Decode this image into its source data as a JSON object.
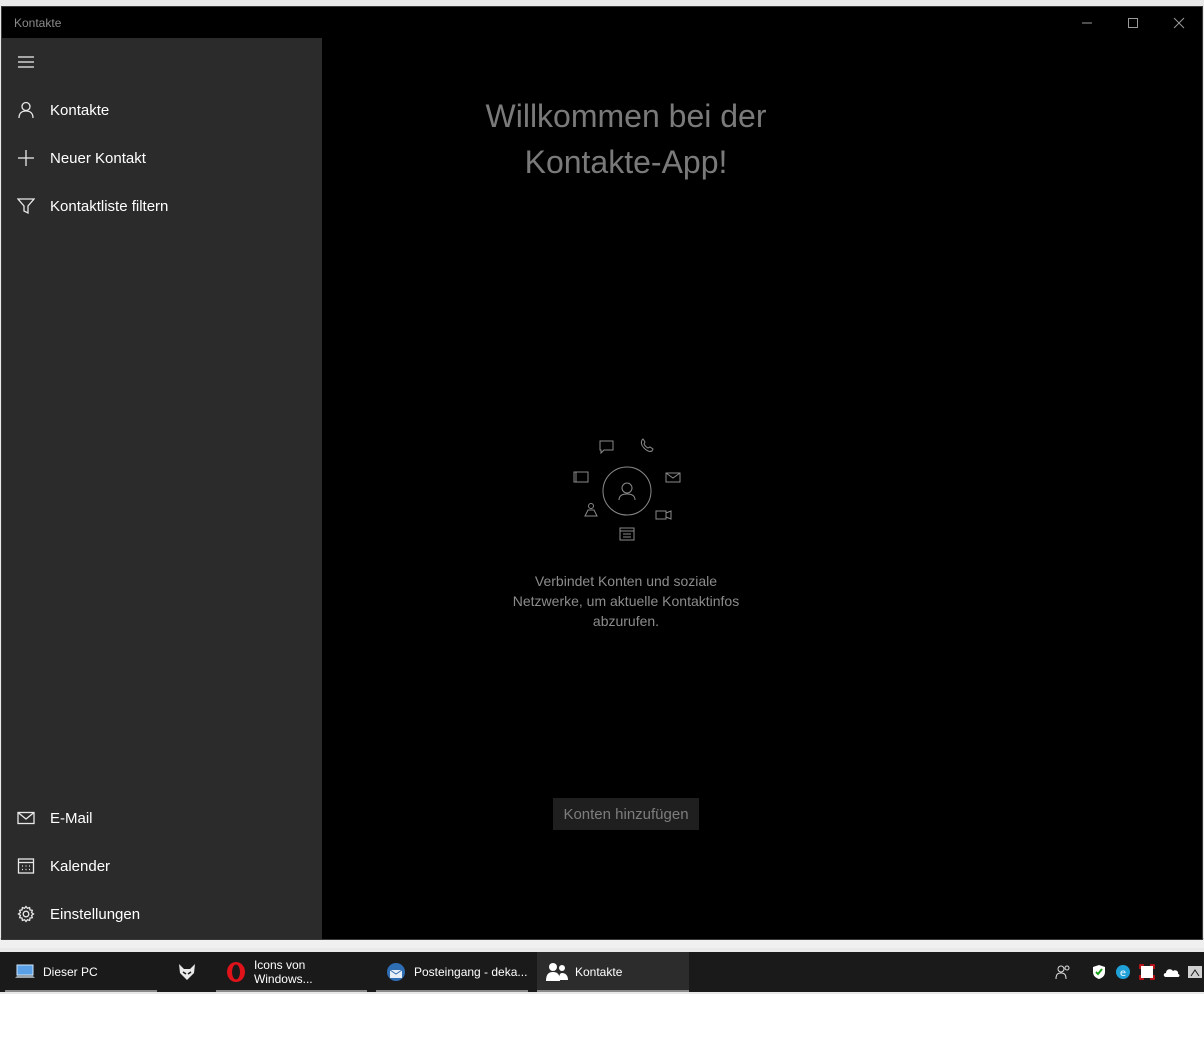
{
  "window": {
    "title": "Kontakte"
  },
  "nav": {
    "top_items": [
      {
        "label": "Kontakte",
        "icon": "person-icon"
      },
      {
        "label": "Neuer Kontakt",
        "icon": "plus-icon"
      },
      {
        "label": "Kontaktliste filtern",
        "icon": "filter-icon"
      }
    ],
    "bottom_items": [
      {
        "label": "E-Mail",
        "icon": "mail-icon"
      },
      {
        "label": "Kalender",
        "icon": "calendar-icon"
      },
      {
        "label": "Einstellungen",
        "icon": "gear-icon"
      }
    ]
  },
  "main": {
    "welcome_line1": "Willkommen bei der",
    "welcome_line2": "Kontakte-App!",
    "description_line1": "Verbindet Konten und soziale",
    "description_line2": "Netzwerke, um aktuelle Kontaktinfos",
    "description_line3": "abzurufen.",
    "add_accounts_label": "Konten hinzufügen"
  },
  "taskbar": {
    "items": [
      {
        "label": "Dieser PC",
        "icon": "computer-icon"
      },
      {
        "label": "",
        "icon": "fox-app-icon"
      },
      {
        "label": "Icons von Windows...",
        "icon": "opera-icon"
      },
      {
        "label": "Posteingang - deka...",
        "icon": "thunderbird-icon"
      },
      {
        "label": "Kontakte",
        "icon": "people-icon"
      }
    ],
    "tray_icons": [
      "people-tray-icon",
      "shield-icon",
      "edge-icon",
      "capture-icon",
      "onedrive-icon",
      "app-tray-icon"
    ]
  },
  "colors": {
    "window_bg": "#000000",
    "nav_bg": "#2b2b2b",
    "taskbar_bg": "#1a1a1a",
    "opera_red": "#e0121a"
  }
}
